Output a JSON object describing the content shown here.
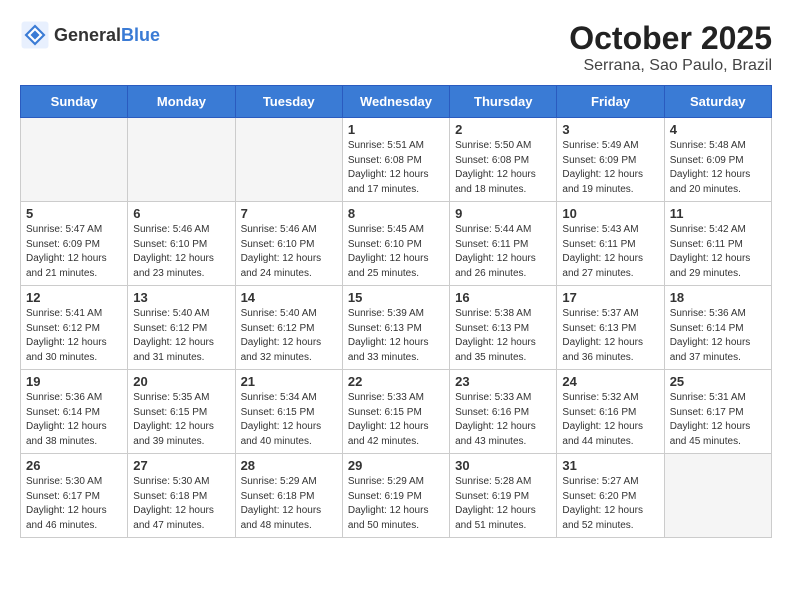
{
  "logo": {
    "general": "General",
    "blue": "Blue"
  },
  "title": "October 2025",
  "location": "Serrana, Sao Paulo, Brazil",
  "days_header": [
    "Sunday",
    "Monday",
    "Tuesday",
    "Wednesday",
    "Thursday",
    "Friday",
    "Saturday"
  ],
  "weeks": [
    [
      {
        "day": "",
        "info": ""
      },
      {
        "day": "",
        "info": ""
      },
      {
        "day": "",
        "info": ""
      },
      {
        "day": "1",
        "info": "Sunrise: 5:51 AM\nSunset: 6:08 PM\nDaylight: 12 hours\nand 17 minutes."
      },
      {
        "day": "2",
        "info": "Sunrise: 5:50 AM\nSunset: 6:08 PM\nDaylight: 12 hours\nand 18 minutes."
      },
      {
        "day": "3",
        "info": "Sunrise: 5:49 AM\nSunset: 6:09 PM\nDaylight: 12 hours\nand 19 minutes."
      },
      {
        "day": "4",
        "info": "Sunrise: 5:48 AM\nSunset: 6:09 PM\nDaylight: 12 hours\nand 20 minutes."
      }
    ],
    [
      {
        "day": "5",
        "info": "Sunrise: 5:47 AM\nSunset: 6:09 PM\nDaylight: 12 hours\nand 21 minutes."
      },
      {
        "day": "6",
        "info": "Sunrise: 5:46 AM\nSunset: 6:10 PM\nDaylight: 12 hours\nand 23 minutes."
      },
      {
        "day": "7",
        "info": "Sunrise: 5:46 AM\nSunset: 6:10 PM\nDaylight: 12 hours\nand 24 minutes."
      },
      {
        "day": "8",
        "info": "Sunrise: 5:45 AM\nSunset: 6:10 PM\nDaylight: 12 hours\nand 25 minutes."
      },
      {
        "day": "9",
        "info": "Sunrise: 5:44 AM\nSunset: 6:11 PM\nDaylight: 12 hours\nand 26 minutes."
      },
      {
        "day": "10",
        "info": "Sunrise: 5:43 AM\nSunset: 6:11 PM\nDaylight: 12 hours\nand 27 minutes."
      },
      {
        "day": "11",
        "info": "Sunrise: 5:42 AM\nSunset: 6:11 PM\nDaylight: 12 hours\nand 29 minutes."
      }
    ],
    [
      {
        "day": "12",
        "info": "Sunrise: 5:41 AM\nSunset: 6:12 PM\nDaylight: 12 hours\nand 30 minutes."
      },
      {
        "day": "13",
        "info": "Sunrise: 5:40 AM\nSunset: 6:12 PM\nDaylight: 12 hours\nand 31 minutes."
      },
      {
        "day": "14",
        "info": "Sunrise: 5:40 AM\nSunset: 6:12 PM\nDaylight: 12 hours\nand 32 minutes."
      },
      {
        "day": "15",
        "info": "Sunrise: 5:39 AM\nSunset: 6:13 PM\nDaylight: 12 hours\nand 33 minutes."
      },
      {
        "day": "16",
        "info": "Sunrise: 5:38 AM\nSunset: 6:13 PM\nDaylight: 12 hours\nand 35 minutes."
      },
      {
        "day": "17",
        "info": "Sunrise: 5:37 AM\nSunset: 6:13 PM\nDaylight: 12 hours\nand 36 minutes."
      },
      {
        "day": "18",
        "info": "Sunrise: 5:36 AM\nSunset: 6:14 PM\nDaylight: 12 hours\nand 37 minutes."
      }
    ],
    [
      {
        "day": "19",
        "info": "Sunrise: 5:36 AM\nSunset: 6:14 PM\nDaylight: 12 hours\nand 38 minutes."
      },
      {
        "day": "20",
        "info": "Sunrise: 5:35 AM\nSunset: 6:15 PM\nDaylight: 12 hours\nand 39 minutes."
      },
      {
        "day": "21",
        "info": "Sunrise: 5:34 AM\nSunset: 6:15 PM\nDaylight: 12 hours\nand 40 minutes."
      },
      {
        "day": "22",
        "info": "Sunrise: 5:33 AM\nSunset: 6:15 PM\nDaylight: 12 hours\nand 42 minutes."
      },
      {
        "day": "23",
        "info": "Sunrise: 5:33 AM\nSunset: 6:16 PM\nDaylight: 12 hours\nand 43 minutes."
      },
      {
        "day": "24",
        "info": "Sunrise: 5:32 AM\nSunset: 6:16 PM\nDaylight: 12 hours\nand 44 minutes."
      },
      {
        "day": "25",
        "info": "Sunrise: 5:31 AM\nSunset: 6:17 PM\nDaylight: 12 hours\nand 45 minutes."
      }
    ],
    [
      {
        "day": "26",
        "info": "Sunrise: 5:30 AM\nSunset: 6:17 PM\nDaylight: 12 hours\nand 46 minutes."
      },
      {
        "day": "27",
        "info": "Sunrise: 5:30 AM\nSunset: 6:18 PM\nDaylight: 12 hours\nand 47 minutes."
      },
      {
        "day": "28",
        "info": "Sunrise: 5:29 AM\nSunset: 6:18 PM\nDaylight: 12 hours\nand 48 minutes."
      },
      {
        "day": "29",
        "info": "Sunrise: 5:29 AM\nSunset: 6:19 PM\nDaylight: 12 hours\nand 50 minutes."
      },
      {
        "day": "30",
        "info": "Sunrise: 5:28 AM\nSunset: 6:19 PM\nDaylight: 12 hours\nand 51 minutes."
      },
      {
        "day": "31",
        "info": "Sunrise: 5:27 AM\nSunset: 6:20 PM\nDaylight: 12 hours\nand 52 minutes."
      },
      {
        "day": "",
        "info": ""
      }
    ]
  ]
}
